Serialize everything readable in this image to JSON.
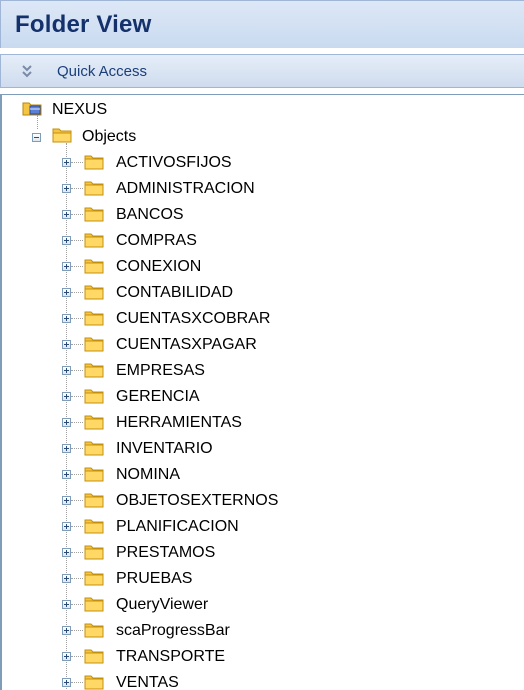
{
  "header": {
    "title": "Folder View"
  },
  "quick_access": {
    "label": "Quick Access",
    "icon": "double-chevron-down-icon"
  },
  "tree": {
    "root": {
      "label": "NEXUS",
      "icon": "database-icon"
    },
    "objects": {
      "label": "Objects",
      "expanded": true,
      "icon": "folder-icon"
    },
    "children": [
      {
        "label": "ACTIVOSFIJOS"
      },
      {
        "label": "ADMINISTRACION"
      },
      {
        "label": "BANCOS"
      },
      {
        "label": "COMPRAS"
      },
      {
        "label": "CONEXION"
      },
      {
        "label": "CONTABILIDAD"
      },
      {
        "label": "CUENTASXCOBRAR"
      },
      {
        "label": "CUENTASXPAGAR"
      },
      {
        "label": "EMPRESAS"
      },
      {
        "label": "GERENCIA"
      },
      {
        "label": "HERRAMIENTAS"
      },
      {
        "label": "INVENTARIO"
      },
      {
        "label": "NOMINA"
      },
      {
        "label": "OBJETOSEXTERNOS"
      },
      {
        "label": "PLANIFICACION"
      },
      {
        "label": "PRESTAMOS"
      },
      {
        "label": "PRUEBAS"
      },
      {
        "label": "QueryViewer"
      },
      {
        "label": "scaProgressBar"
      },
      {
        "label": "TRANSPORTE"
      },
      {
        "label": "VENTAS"
      }
    ]
  },
  "colors": {
    "header_bg": "#c9daf0",
    "header_text": "#14316b",
    "folder_fill": "#f4c542",
    "tree_line": "#a0a0a0"
  }
}
